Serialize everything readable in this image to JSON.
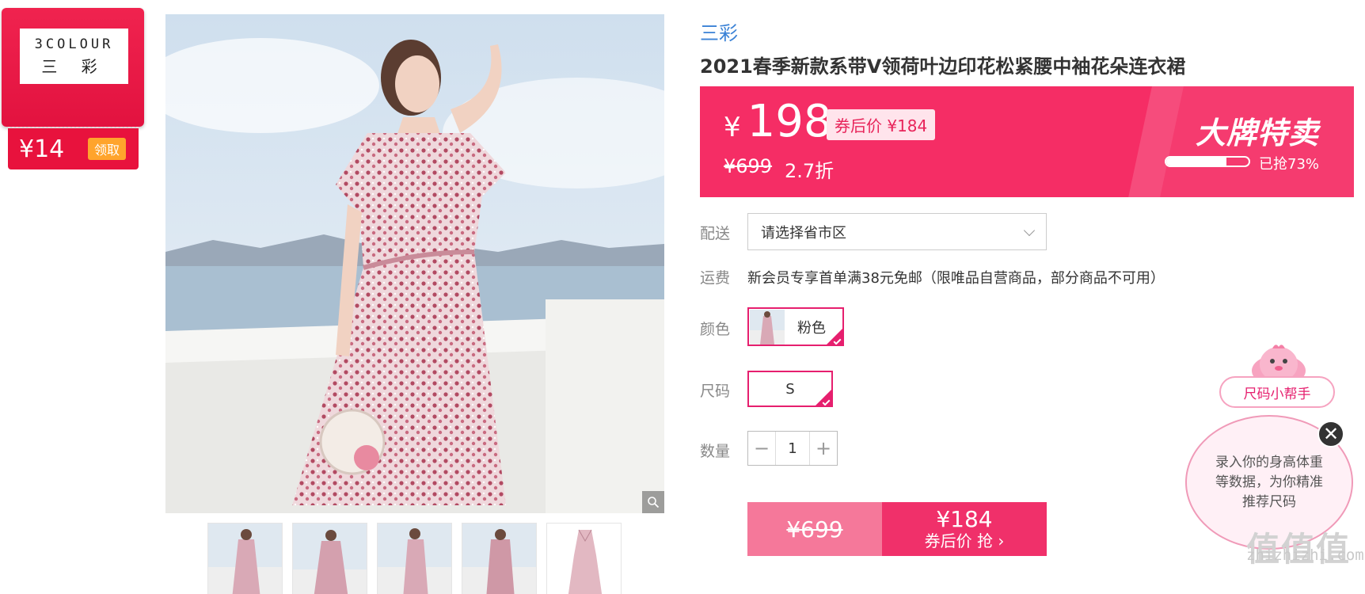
{
  "brand_card": {
    "logo_en": "3COLOUR",
    "logo_cn": "三 彩",
    "coupon_amount": "¥14",
    "coupon_button": "领取"
  },
  "product": {
    "brand": "三彩",
    "title": "2021春季新款系带V领荷叶边印花松紧腰中袖花朵连衣裙"
  },
  "price_banner": {
    "currency": "¥",
    "price": "198",
    "after_coupon": "券后价 ¥184",
    "original_price": "¥699",
    "discount": "2.7折",
    "promo_title": "大牌特卖",
    "sold_percent": 73,
    "sold_label": "已抢73%"
  },
  "delivery": {
    "label": "配送",
    "placeholder": "请选择省市区"
  },
  "shipping": {
    "label": "运费",
    "text": "新会员专享首单满38元免邮（限唯品自营商品，部分商品不可用）"
  },
  "color": {
    "label": "颜色",
    "selected": "粉色"
  },
  "size": {
    "label": "尺码",
    "selected": "S"
  },
  "quantity": {
    "label": "数量",
    "minus": "−",
    "value": "1",
    "plus": "+"
  },
  "buy": {
    "original": "¥699",
    "price": "¥184",
    "action": "券后价 抢 ›"
  },
  "size_helper": {
    "title": "尺码小帮手",
    "message": "录入你的身高体重等数据，为你精准推荐尺码",
    "close": "✕"
  },
  "watermark": {
    "cn": "值值值",
    "url": "zhizhizhi.com"
  },
  "colors": {
    "accent": "#f52d65",
    "selected_border": "#e61f6e",
    "brand_link": "#3b82d6",
    "coupon_button": "#ffa42c"
  }
}
